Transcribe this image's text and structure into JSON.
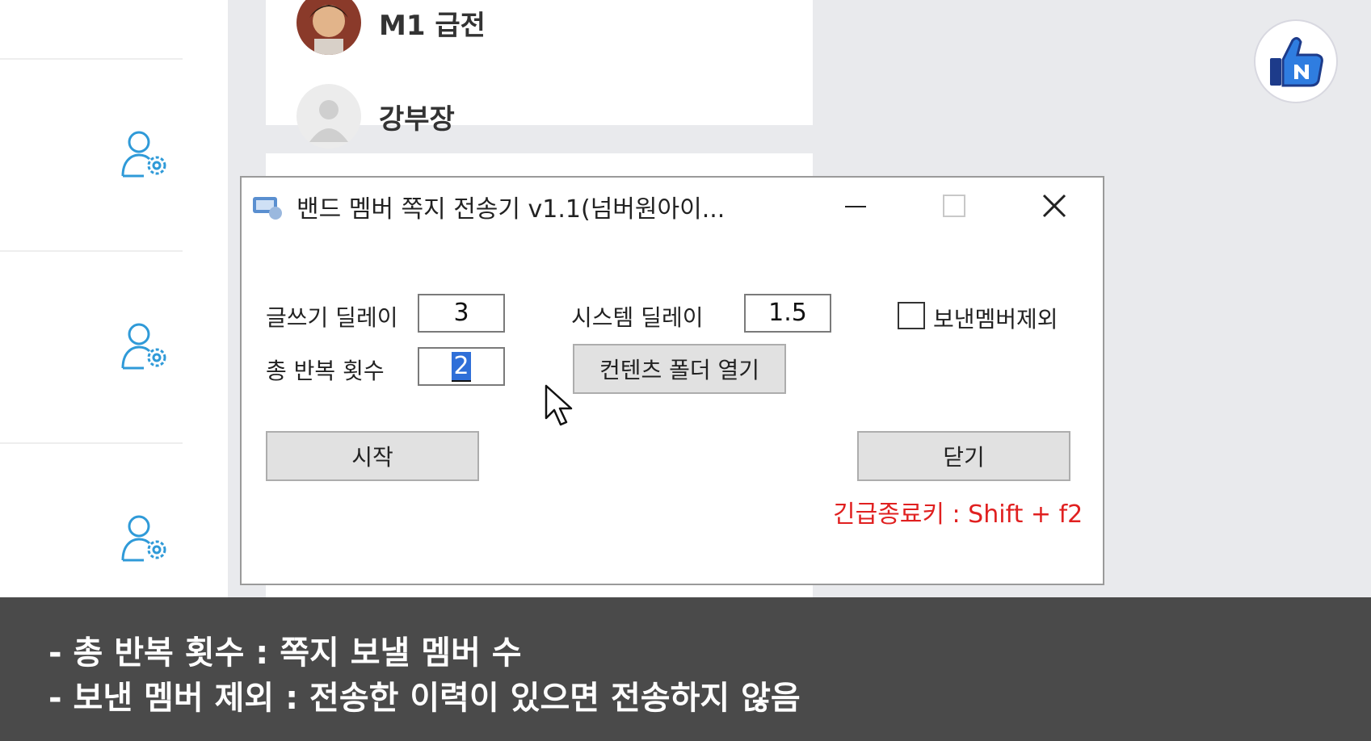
{
  "background": {
    "members": [
      {
        "name": "M1 급전"
      },
      {
        "name": "강부장"
      }
    ],
    "icons": {
      "member_settings": "user-gear-icon",
      "brand": "thumbs-up-n-badge-icon"
    }
  },
  "dialog": {
    "title": "밴드 멤버 쪽지 전송기 v1.1(넘버원아이...",
    "writing_delay_label": "글쓰기 딜레이",
    "writing_delay_value": "3",
    "system_delay_label": "시스템 딜레이",
    "system_delay_value": "1.5",
    "repeat_count_label": "총 반복 횟수",
    "repeat_count_value": "2",
    "exclude_sent_label": "보낸멤버제외",
    "exclude_sent_checked": false,
    "open_folder_label": "컨텐츠 폴더 열기",
    "start_label": "시작",
    "close_label": "닫기",
    "hotkey_text": "긴급종료키 : Shift + f2"
  },
  "caption": {
    "line1": "- 총 반복 횟수 : 쪽지 보낼 멤버 수",
    "line2": "- 보낸 멤버 제외 : 전송한 이력이 있으면 전송하지 않음"
  },
  "colors": {
    "accent_blue": "#2f9ad8",
    "hotkey_red": "#e02020",
    "selection_blue": "#2f6fd8",
    "caption_bg": "#4a4a4a"
  }
}
